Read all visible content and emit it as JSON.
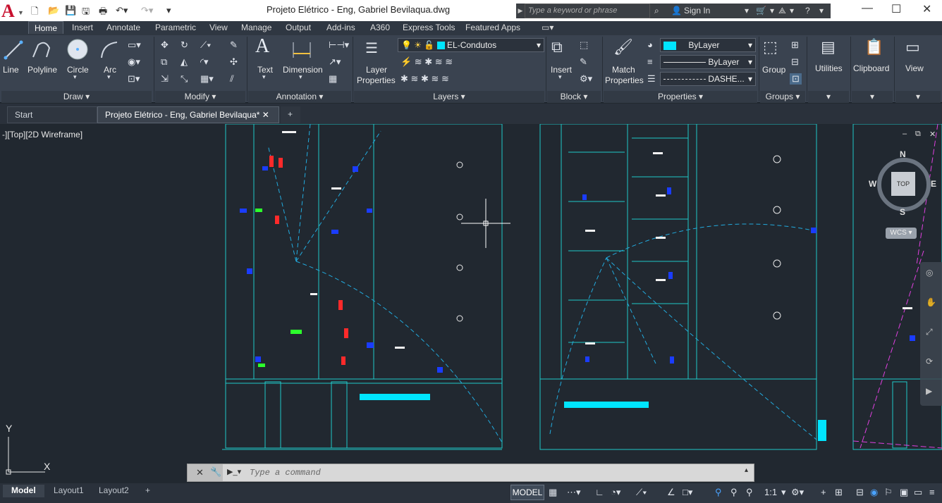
{
  "window": {
    "title": "Projeto Elétrico -  Eng, Gabriel Bevilaqua.dwg",
    "search_placeholder": "Type a keyword or phrase",
    "sign_in": "Sign In"
  },
  "app_menu": {
    "logo_letter": "A"
  },
  "ribbon_tabs": [
    "Home",
    "Insert",
    "Annotate",
    "Parametric",
    "View",
    "Manage",
    "Output",
    "Add-ins",
    "A360",
    "Express Tools",
    "Featured Apps"
  ],
  "ribbon": {
    "draw": {
      "title": "Draw",
      "line": "Line",
      "polyline": "Polyline",
      "circle": "Circle",
      "arc": "Arc"
    },
    "modify": {
      "title": "Modify"
    },
    "annotation": {
      "title": "Annotation",
      "text": "Text",
      "dimension": "Dimension"
    },
    "layers": {
      "title": "Layers",
      "layer_properties_1": "Layer",
      "layer_properties_2": "Properties",
      "current_layer": "EL-Condutos"
    },
    "block": {
      "title": "Block",
      "insert": "Insert"
    },
    "properties": {
      "title": "Properties",
      "match_1": "Match",
      "match_2": "Properties",
      "color": "ByLayer",
      "lineweight": "ByLayer",
      "linetype": "DASHE..."
    },
    "groups": {
      "title": "Groups",
      "group": "Group"
    },
    "utilities": "Utilities",
    "clipboard": "Clipboard",
    "view": "View"
  },
  "doc_tabs": {
    "start": "Start",
    "active": "Projeto Elétrico -  Eng, Gabriel Bevilaqua*"
  },
  "viewport": {
    "label": "-][Top][2D Wireframe]",
    "viewcube": {
      "top": "TOP",
      "n": "N",
      "s": "S",
      "e": "E",
      "w": "W",
      "wcs": "WCS"
    },
    "ucs": {
      "x": "X",
      "y": "Y"
    }
  },
  "command_line": {
    "placeholder": "Type a command"
  },
  "layout_tabs": [
    "Model",
    "Layout1",
    "Layout2"
  ],
  "status_bar": {
    "model": "MODEL",
    "scale": "1:1"
  },
  "colors": {
    "accent_blue": "#1e8fe6",
    "drawing_cyan": "#22d3d3",
    "drawing_bg": "#212830"
  }
}
